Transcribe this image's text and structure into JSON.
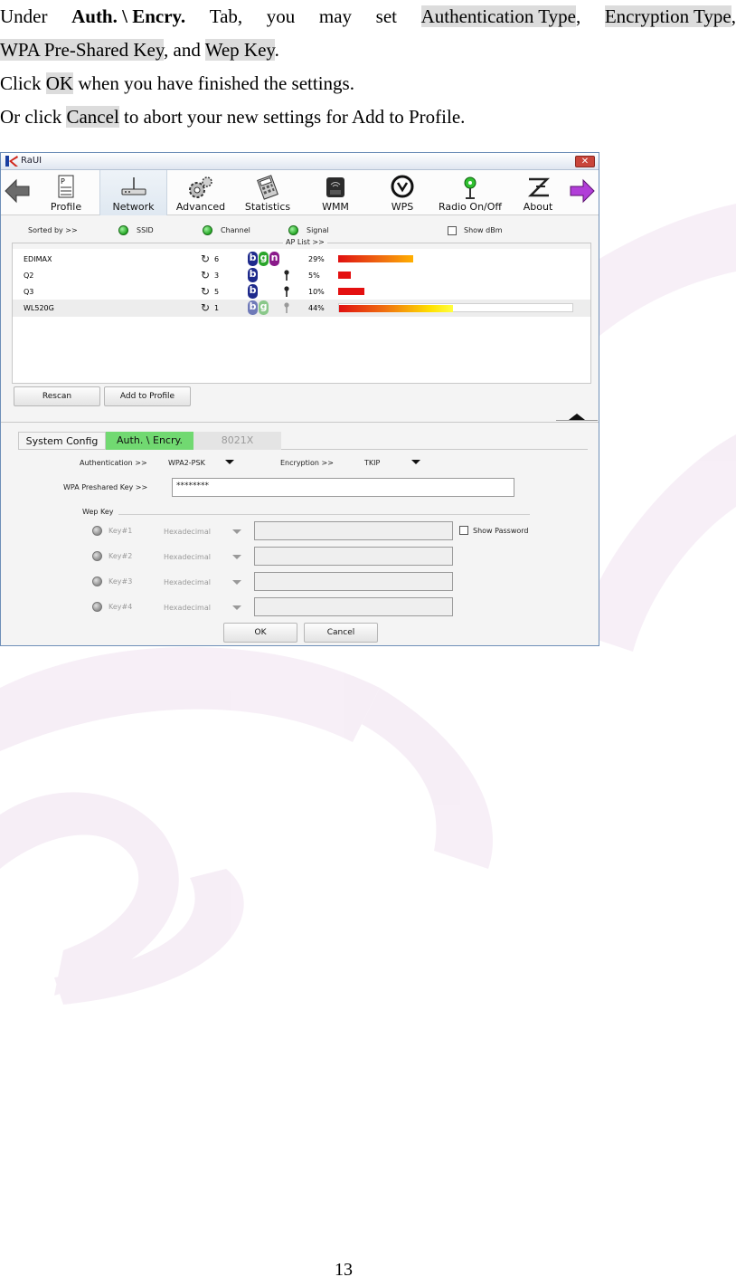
{
  "manual": {
    "line1": {
      "w1": "Under",
      "tab_name": "Auth. \\ Encry.",
      "w2": "Tab,",
      "w3": "you",
      "w4": "may",
      "w5": "set",
      "auth_type": "Authentication Type",
      "comma": ",",
      "enc_type": "Encryption Type",
      "end_comma": ","
    },
    "line2": {
      "wpa_key": "WPA Pre-Shared Key",
      "and": ", and ",
      "wep_key": "Wep Key",
      "end": "."
    },
    "line3": {
      "pre": "Click ",
      "ok": "OK",
      "post": " when you have finished the settings."
    },
    "line4": {
      "pre": "Or click ",
      "cancel": "Cancel",
      "post": " to abort your new settings for Add to Profile."
    },
    "page_number": "13"
  },
  "window": {
    "title": "RaUI",
    "close_glyph": "✕",
    "toolbar": {
      "back_icon": "back-arrow-icon",
      "forward_icon": "forward-arrow-icon",
      "buttons": [
        {
          "label": "Profile",
          "icon": "profile-icon",
          "active": false
        },
        {
          "label": "Network",
          "icon": "network-icon",
          "active": true
        },
        {
          "label": "Advanced",
          "icon": "advanced-gears-icon",
          "active": false
        },
        {
          "label": "Statistics",
          "icon": "statistics-calculator-icon",
          "active": false
        },
        {
          "label": "WMM",
          "icon": "wmm-qos-icon",
          "active": false
        },
        {
          "label": "WPS",
          "icon": "wps-icon",
          "active": false
        },
        {
          "label": "Radio On/Off",
          "icon": "radio-icon",
          "active": false
        },
        {
          "label": "About",
          "icon": "about-icon",
          "active": false
        }
      ]
    },
    "sortbar": {
      "sorted_by": "Sorted by >>",
      "ssid": "SSID",
      "channel": "Channel",
      "signal": "Signal",
      "show_dbm": "Show dBm"
    },
    "ap_list": {
      "legend": "AP List >>",
      "rows": [
        {
          "ssid": "EDIMAX",
          "channel": "6",
          "modes": [
            "b",
            "g",
            "n"
          ],
          "locked": false,
          "signal_text": "29%",
          "signal": 29,
          "selected": false
        },
        {
          "ssid": "Q2",
          "channel": "3",
          "modes": [
            "b"
          ],
          "locked": true,
          "signal_text": "5%",
          "signal": 5,
          "selected": false
        },
        {
          "ssid": "Q3",
          "channel": "5",
          "modes": [
            "b"
          ],
          "locked": true,
          "signal_text": "10%",
          "signal": 10,
          "selected": false
        },
        {
          "ssid": "WL520G",
          "channel": "1",
          "modes": [
            "b",
            "g"
          ],
          "locked": true,
          "signal_text": "44%",
          "signal": 44,
          "selected": true
        }
      ]
    },
    "buttons": {
      "rescan": "Rescan",
      "add_to_profile": "Add to Profile",
      "ok": "OK",
      "cancel": "Cancel"
    },
    "tabs": {
      "system_config": "System Config",
      "auth_encry": "Auth. \\ Encry.",
      "x8021": "8021X"
    },
    "auth": {
      "authentication_label": "Authentication >>",
      "authentication_value": "WPA2-PSK",
      "encryption_label": "Encryption >>",
      "encryption_value": "TKIP",
      "psk_label": "WPA Preshared Key >>",
      "psk_value": "********",
      "wep_key_label": "Wep Key",
      "show_password": "Show Password",
      "wep_keys": [
        {
          "label": "Key#1",
          "format": "Hexadecimal"
        },
        {
          "label": "Key#2",
          "format": "Hexadecimal"
        },
        {
          "label": "Key#3",
          "format": "Hexadecimal"
        },
        {
          "label": "Key#4",
          "format": "Hexadecimal"
        }
      ]
    }
  }
}
